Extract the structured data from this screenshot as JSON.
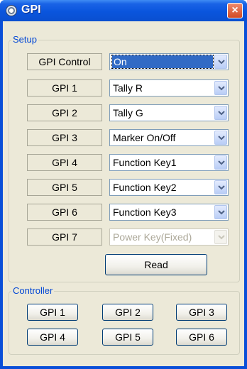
{
  "window": {
    "title": "GPI",
    "close_symbol": "×"
  },
  "setup": {
    "title": "Setup",
    "rows": [
      {
        "label": "GPI Control",
        "value": "On",
        "selected": true,
        "enabled": true
      },
      {
        "label": "GPI 1",
        "value": "Tally R",
        "enabled": true
      },
      {
        "label": "GPI 2",
        "value": "Tally G",
        "enabled": true
      },
      {
        "label": "GPI 3",
        "value": "Marker On/Off",
        "enabled": true
      },
      {
        "label": "GPI 4",
        "value": "Function Key1",
        "enabled": true
      },
      {
        "label": "GPI 5",
        "value": "Function Key2",
        "enabled": true
      },
      {
        "label": "GPI 6",
        "value": "Function Key3",
        "enabled": true
      },
      {
        "label": "GPI 7",
        "value": "Power Key(Fixed)",
        "enabled": false
      }
    ],
    "read_button": "Read"
  },
  "controller": {
    "title": "Controller",
    "buttons": [
      "GPI 1",
      "GPI 2",
      "GPI 3",
      "GPI 4",
      "GPI 5",
      "GPI 6"
    ]
  },
  "colors": {
    "titlebar": "#0a55dd",
    "group_title": "#0046d5",
    "selection": "#316ac5",
    "dialog_bg": "#ece9d8"
  }
}
